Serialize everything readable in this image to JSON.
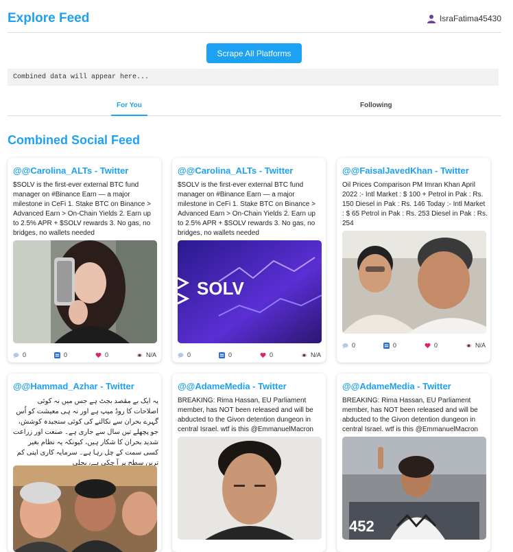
{
  "header": {
    "title": "Explore Feed",
    "username": "IsraFatima45430"
  },
  "actions": {
    "scrape_label": "Scrape All Platforms"
  },
  "output": {
    "text": "Combined data will appear here..."
  },
  "tabs": [
    {
      "label": "For You",
      "active": true
    },
    {
      "label": "Following",
      "active": false
    }
  ],
  "feed": {
    "title": "Combined Social Feed",
    "posts": [
      {
        "title": "@@Carolina_ALTs - Twitter",
        "text": "$SOLV is the first-ever external BTC fund manager on #Binance Earn — a major milestone in CeFi 1. Stake BTC on Binance > Advanced Earn > On-Chain Yields 2. Earn up to 2.5% APR + $SOLV rewards 3. No gas, no bridges, no wallets needed",
        "image": "selfie-photo",
        "comments": "0",
        "retweets": "0",
        "likes": "0",
        "views": "N/A"
      },
      {
        "title": "@@Carolina_ALTs - Twitter",
        "text": "$SOLV is the first-ever external BTC fund manager on #Binance Earn — a major milestone in CeFi 1. Stake BTC on Binance > Advanced Earn > On-Chain Yields 2. Earn up to 2.5% APR + $SOLV rewards 3. No gas, no bridges, no wallets needed",
        "image": "solv-banner",
        "image_text": "SOLV",
        "comments": "0",
        "retweets": "0",
        "likes": "0",
        "views": "N/A"
      },
      {
        "title": "@@FaisalJavedKhan - Twitter",
        "text": "Oil Prices Comparison PM Imran Khan April 2022 :- Intl Market : $ 100 + Petrol in Pak : Rs. 150 Diesel in Pak : Rs. 146 Today :- Intl Market : $ 65 Petrol in Pak : Rs. 253 Diesel in Pak : Rs. 254",
        "image": "two-men-photo",
        "comments": "0",
        "retweets": "0",
        "likes": "0",
        "views": "N/A"
      },
      {
        "title": "@@Hammad_Azhar - Twitter",
        "text": "یہ ایک بے مقصد بجٹ ہے جس میں نہ کوئی اصلاحات کا روڈ میپ ہے اور نہ ہی معیشت کو اُس گہرے بحران سے نکالنے کی کوئی سنجیدہ کوشش، جو پچھلے تین سال سے جاری ہے۔ صنعت اور زراعت شدید بحران کا شکار ہیں، کیونکہ یہ نظام بغیر کسی سمت کے چل رہا ہے۔ سرمایہ کاری اپنی کم ترین سطح پر آ چکی ہے، بجلی",
        "image": "group-photo"
      },
      {
        "title": "@@AdameMedia - Twitter",
        "text": "BREAKING: Rima Hassan, EU Parliament member, has NOT been released and will be abducted to the Givon detention dungeon in central Israel. wtf is this @EmmanuelMacron",
        "image": "portrait-photo"
      },
      {
        "title": "@@AdameMedia - Twitter",
        "text": "BREAKING: Rima Hassan, EU Parliament member, has NOT been released and will be abducted to the Givon detention dungeon in central Israel. wtf is this @EmmanuelMacron",
        "image": "parliament-photo",
        "image_text": "452"
      }
    ]
  },
  "colors": {
    "accent": "#1da1f2",
    "like": "#e0245e"
  }
}
